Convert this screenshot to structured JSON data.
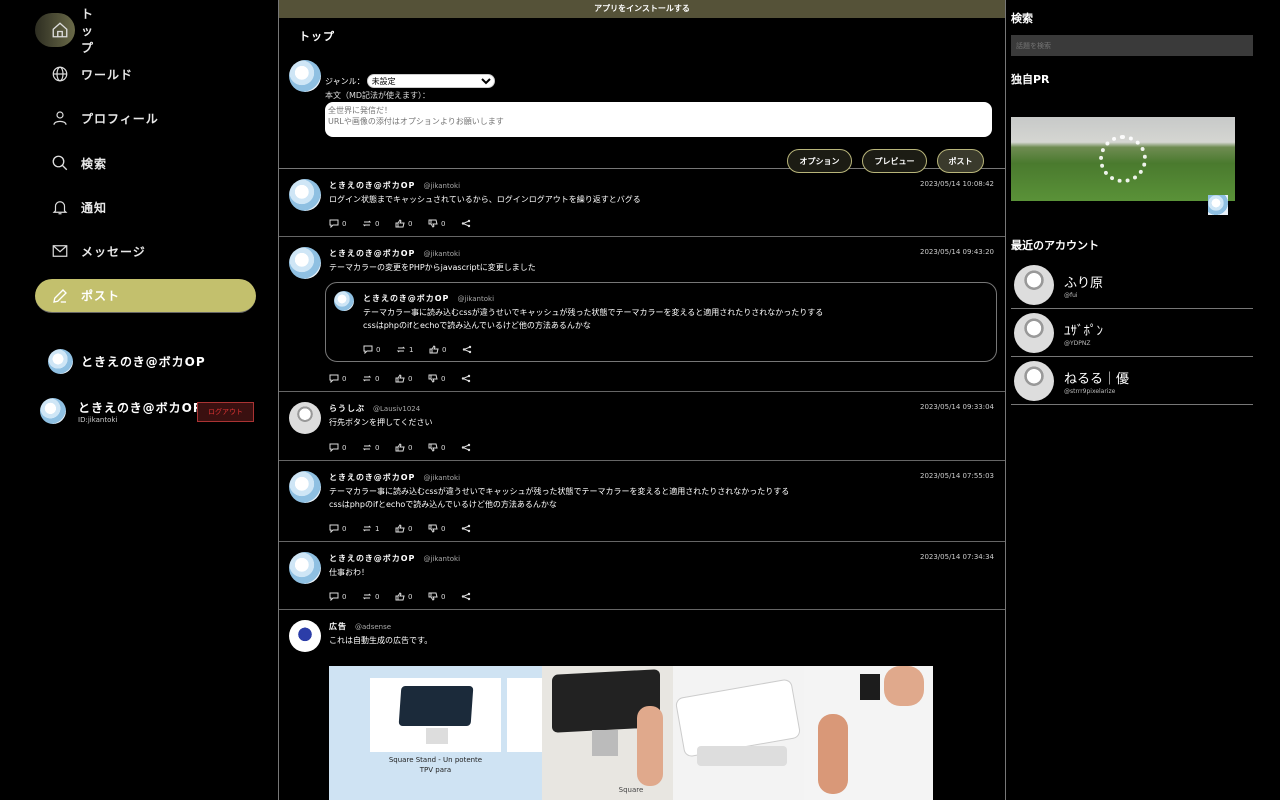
{
  "nav": {
    "items": [
      {
        "label": "トップ",
        "icon": "home-icon"
      },
      {
        "label": "ワールド",
        "icon": "globe-icon"
      },
      {
        "label": "プロフィール",
        "icon": "user-icon"
      },
      {
        "label": "検索",
        "icon": "search-icon"
      },
      {
        "label": "通知",
        "icon": "bell-icon"
      },
      {
        "label": "メッセージ",
        "icon": "mail-icon"
      },
      {
        "label": "ポスト",
        "icon": "pencil-icon"
      }
    ]
  },
  "sidebar_account": {
    "name": "ときえのき@ボカOP"
  },
  "current_account": {
    "name": "ときえのき@ボカOP",
    "id": "ID:jikantoki",
    "logout": "ログアウト"
  },
  "banner": "アプリをインストールする",
  "compose": {
    "title": "トップ",
    "genre_label": "ジャンル：",
    "genre_value": "未設定",
    "body_label": "本文（MD記法が使えます）：",
    "placeholder": "全世界に発信だ！\nURLや画像の添付はオプションよりお願いします",
    "buttons": {
      "option": "オプション",
      "preview": "プレビュー",
      "post": "ポスト"
    }
  },
  "posts": [
    {
      "name": "ときえのき@ボカOP",
      "handle": "@jikantoki",
      "time": "2023/05/14 10:08:42",
      "text": "ログイン状態までキャッシュされているから、ログインログアウトを繰り返すとバグる",
      "reply": "0",
      "repost": "0",
      "like": "0",
      "dislike": "0"
    },
    {
      "name": "ときえのき@ボカOP",
      "handle": "@jikantoki",
      "time": "2023/05/14 09:43:20",
      "text": "テーマカラーの変更をPHPからjavascriptに変更しました",
      "reply": "0",
      "repost": "0",
      "like": "0",
      "dislike": "0",
      "quote": {
        "name": "ときえのき@ボカOP",
        "handle": "@jikantoki",
        "line1": "テーマカラー事に読み込むcssが違うせいでキャッシュが残った状態でテーマカラーを変えると適用されたりされなかったりする",
        "line2": "cssはphpのifとechoで読み込んでいるけど他の方法あるんかな",
        "reply": "0",
        "repost": "1",
        "like": "0"
      }
    },
    {
      "name": "らうしぶ",
      "handle": "@Lausiv1024",
      "time": "2023/05/14 09:33:04",
      "text": "行先ボタンを押してください",
      "reply": "0",
      "repost": "0",
      "like": "0",
      "dislike": "0"
    },
    {
      "name": "ときえのき@ボカOP",
      "handle": "@jikantoki",
      "time": "2023/05/14 07:55:03",
      "line1": "テーマカラー事に読み込むcssが違うせいでキャッシュが残った状態でテーマカラーを変えると適用されたりされなかったりする",
      "line2": "cssはphpのifとechoで読み込んでいるけど他の方法あるんかな",
      "reply": "0",
      "repost": "1",
      "like": "0",
      "dislike": "0"
    },
    {
      "name": "ときえのき@ボカOP",
      "handle": "@jikantoki",
      "time": "2023/05/14 07:34:34",
      "text": "仕事おわ！",
      "reply": "0",
      "repost": "0",
      "like": "0",
      "dislike": "0"
    }
  ],
  "ad": {
    "name": "広告",
    "handle": "@adsense",
    "text": "これは自動生成の広告です。",
    "caption1": "Square Stand - Un potente",
    "caption2": "TPV para",
    "footer": "Square"
  },
  "right": {
    "search_title": "検索",
    "search_placeholder": "話題を検索",
    "pr_title": "独自PR",
    "recent_title": "最近のアカウント",
    "accounts": [
      {
        "name": "ふり原",
        "id": "@fui"
      },
      {
        "name": "ﾕｻﾞﾎﾟﾝ",
        "id": "@YDPNZ"
      },
      {
        "name": "ねるる｜優",
        "id": "@strrr9pixelarize"
      }
    ]
  }
}
